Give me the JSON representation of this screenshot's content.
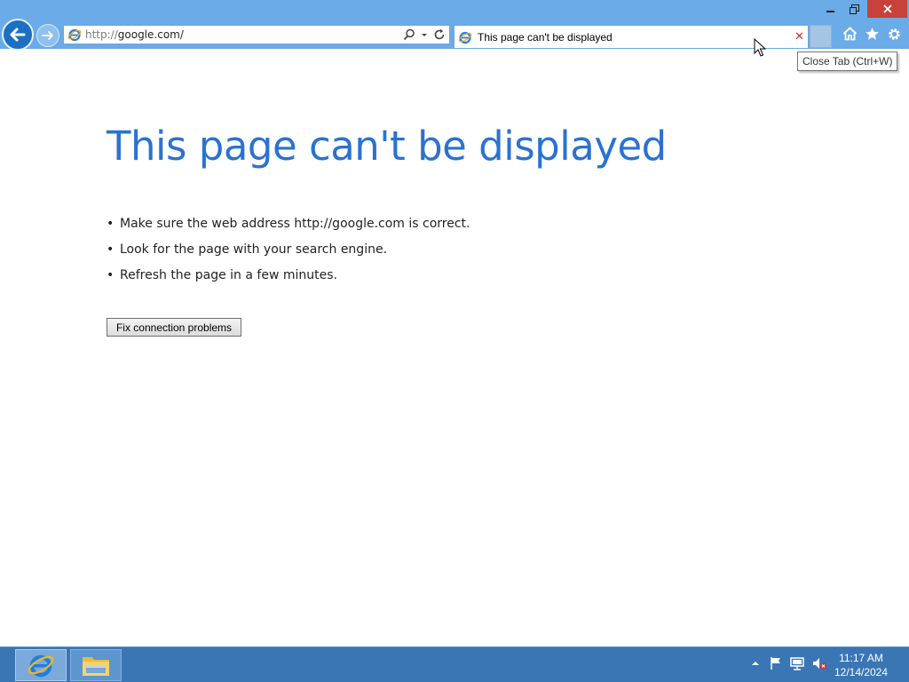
{
  "browser": {
    "address_url": "http://google.com/",
    "tab_title": "This page can't be displayed",
    "tooltip": "Close Tab (Ctrl+W)"
  },
  "error_page": {
    "heading": "This page can't be displayed",
    "tips": [
      "Make sure the web address http://google.com is correct.",
      "Look for the page with your search engine.",
      "Refresh the page in a few minutes."
    ],
    "fix_button": "Fix connection problems"
  },
  "taskbar": {
    "time": "11:17 AM",
    "date": "12/14/2024"
  },
  "icons": [
    "back-arrow-icon",
    "forward-arrow-icon",
    "ie-icon",
    "search-icon",
    "refresh-icon",
    "close-tab-icon",
    "home-icon",
    "favorites-star-icon",
    "gear-icon",
    "file-explorer-icon",
    "show-hidden-icons-icon",
    "action-center-flag-icon",
    "network-icon",
    "volume-muted-icon"
  ],
  "colors": {
    "title_bar": "#6aabe8",
    "heading": "#2a72d2",
    "taskbar": "#3b76b4",
    "close_window": "#c7423a",
    "close_tab": "#d32f2f"
  }
}
